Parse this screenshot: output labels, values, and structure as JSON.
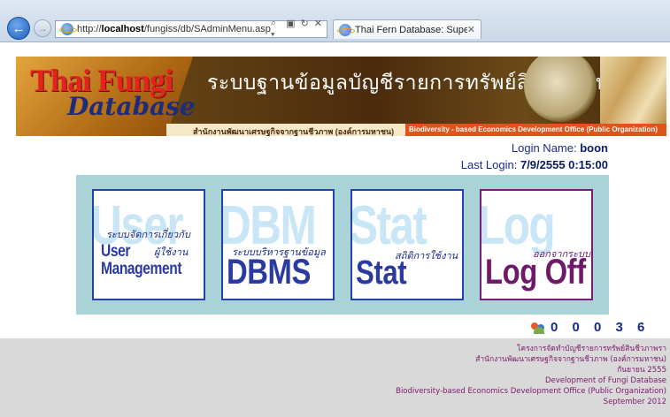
{
  "browser": {
    "url_prefix": "http://",
    "url_host": "localhost",
    "url_path": "/fungiss/db/SAdminMenu.asp",
    "address_tools": [
      "⌕ ▾",
      "▣",
      "↻",
      "✕"
    ],
    "tab_title": "Thai Fern Database: SuperA...",
    "tab_close": "✕"
  },
  "banner": {
    "logo_line1": "Thai Fungi",
    "logo_line2": "Database",
    "title_thai": "ระบบฐานข้อมูลบัญชีรายการทรัพย์สินชีวภาพรา",
    "subtitle_thai": "สำนักงานพัฒนาเศรษฐกิจจากฐานชีวภาพ (องค์การมหาชน)",
    "subtitle_eng": "Biodiversity - based Economics Development Office (Public Organization)"
  },
  "login": {
    "name_label": "Login Name:",
    "name_value": "boon",
    "last_label": "Last Login:",
    "last_value": "7/9/2555 0:15:00"
  },
  "menu": {
    "user": {
      "ghost": "User",
      "thai1": "ระบบจัดการเกี่ยวกับ",
      "thai2": "ผู้ใช้งาน",
      "big1": "User",
      "big2": "Management"
    },
    "dbms": {
      "ghost": "DBM",
      "thai": "ระบบบริหารฐานข้อมูล",
      "big": "DBMS"
    },
    "stat": {
      "ghost": "Stat",
      "thai": "สถิติการใช้งาน",
      "big": "Stat"
    },
    "logoff": {
      "ghost": "Log",
      "thai": "ออกจากระบบ",
      "big": "Log Off"
    }
  },
  "counter": {
    "digits": "0 0 0 3 6"
  },
  "footer": {
    "lines": [
      "โครงการจัดทำบัญชีรายการทรัพย์สินชีวภาพรา",
      "สำนักงานพัฒนาเศรษฐกิจจากฐานชีวภาพ (องค์การมหาชน)",
      "กันยายน 2555",
      "Development of Fungi Database",
      "Biodiversity-based Economics Development Office (Public Organization)",
      "September 2012"
    ]
  }
}
